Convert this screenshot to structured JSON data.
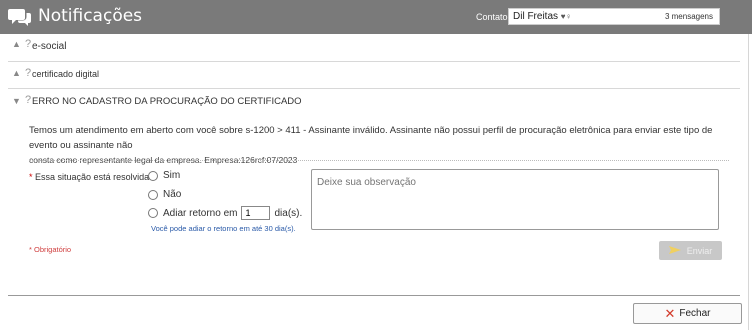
{
  "header": {
    "title": "Notificações",
    "contact_label": "Contato",
    "contact_name": "Dil Freitas",
    "contact_count": "3 mensagens",
    "background_color": "#7a7a7a"
  },
  "sections": [
    {
      "label": "e-social",
      "expanded": false
    },
    {
      "label": "certificado digital",
      "expanded": false
    },
    {
      "label": "ERRO NO CADASTRO DA PROCURAÇÃO DO CERTIFICADO",
      "expanded": true
    }
  ],
  "message": {
    "line1": "Temos um atendimento em aberto com você sobre s-1200 > 411 - Assinante inválido. Assinante não possui perfil de procuração eletrônica para enviar este tipo de evento ou assinante não",
    "line2": "consta como representante legal da empresa. Empresa:126rcf:07/2023"
  },
  "form": {
    "required_marker": "*",
    "question": "Essa situação está resolvida?",
    "options": {
      "yes": "Sim",
      "no": "Não",
      "postpone_prefix": "Adiar retorno em",
      "postpone_suffix": "dia(s)."
    },
    "postpone_days": "1",
    "hint": "Você pode adiar o retorno em até 30 dia(s).",
    "observation_placeholder": "Deixe sua observação",
    "required_note": "* Obrigatório",
    "send_label": "Enviar"
  },
  "footer": {
    "close_label": "Fechar"
  },
  "colors": {
    "accent_link": "#2a5aa8",
    "required_red": "#d04040",
    "close_x_red": "#d23a2a"
  }
}
